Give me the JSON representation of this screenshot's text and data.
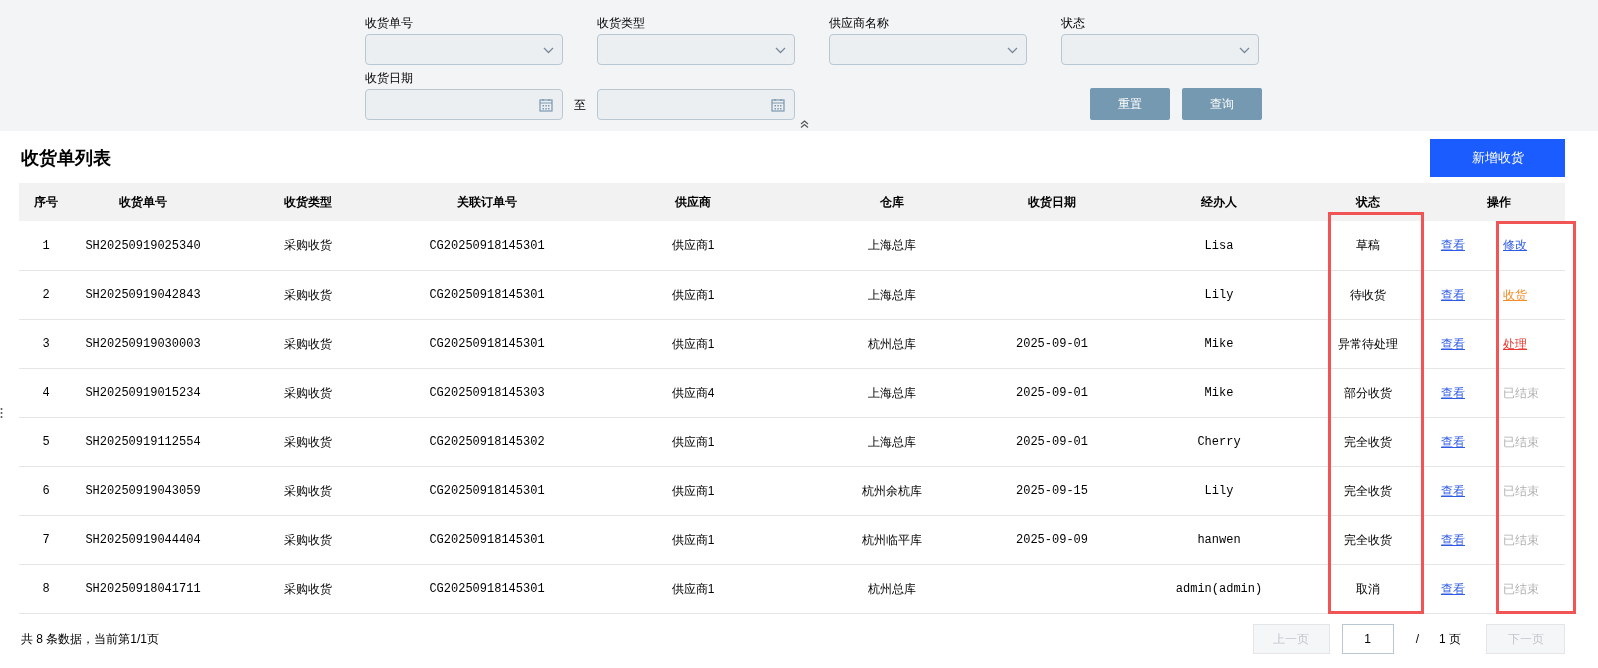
{
  "filters": {
    "selects": [
      {
        "label": "收货单号"
      },
      {
        "label": "收货类型"
      },
      {
        "label": "供应商名称"
      },
      {
        "label": "状态"
      }
    ],
    "date_range": {
      "label": "收货日期",
      "separator": "至"
    },
    "buttons": [
      "重置",
      "查询"
    ]
  },
  "list": {
    "title": "收货单列表",
    "add_button": "新增收货",
    "columns": [
      "序号",
      "收货单号",
      "收货类型",
      "关联订单号",
      "供应商",
      "仓库",
      "收货日期",
      "经办人",
      "状态",
      "操作"
    ],
    "rows": [
      {
        "no": "1",
        "receipt_no": "SH20250919025340",
        "type": "采购收货",
        "order_no": "CG20250918145301",
        "supplier": "供应商1",
        "warehouse": "上海总库",
        "date": "",
        "handler": "Lisa",
        "status": "草稿",
        "view": "查看",
        "action": {
          "label": "修改",
          "kind": "edit"
        }
      },
      {
        "no": "2",
        "receipt_no": "SH20250919042843",
        "type": "采购收货",
        "order_no": "CG20250918145301",
        "supplier": "供应商1",
        "warehouse": "上海总库",
        "date": "",
        "handler": "Lily",
        "status": "待收货",
        "view": "查看",
        "action": {
          "label": "收货",
          "kind": "receive"
        }
      },
      {
        "no": "3",
        "receipt_no": "SH20250919030003",
        "type": "采购收货",
        "order_no": "CG20250918145301",
        "supplier": "供应商1",
        "warehouse": "杭州总库",
        "date": "2025-09-01",
        "handler": "Mike",
        "status": "异常待处理",
        "view": "查看",
        "action": {
          "label": "处理",
          "kind": "process"
        }
      },
      {
        "no": "4",
        "receipt_no": "SH20250919015234",
        "type": "采购收货",
        "order_no": "CG20250918145303",
        "supplier": "供应商4",
        "warehouse": "上海总库",
        "date": "2025-09-01",
        "handler": "Mike",
        "status": "部分收货",
        "view": "查看",
        "action": {
          "label": "已结束",
          "kind": "closed"
        }
      },
      {
        "no": "5",
        "receipt_no": "SH20250919112554",
        "type": "采购收货",
        "order_no": "CG20250918145302",
        "supplier": "供应商1",
        "warehouse": "上海总库",
        "date": "2025-09-01",
        "handler": "Cherry",
        "status": "完全收货",
        "view": "查看",
        "action": {
          "label": "已结束",
          "kind": "closed"
        }
      },
      {
        "no": "6",
        "receipt_no": "SH20250919043059",
        "type": "采购收货",
        "order_no": "CG20250918145301",
        "supplier": "供应商1",
        "warehouse": "杭州余杭库",
        "date": "2025-09-15",
        "handler": "Lily",
        "status": "完全收货",
        "view": "查看",
        "action": {
          "label": "已结束",
          "kind": "closed"
        }
      },
      {
        "no": "7",
        "receipt_no": "SH20250919044404",
        "type": "采购收货",
        "order_no": "CG20250918145301",
        "supplier": "供应商1",
        "warehouse": "杭州临平库",
        "date": "2025-09-09",
        "handler": "hanwen",
        "status": "完全收货",
        "view": "查看",
        "action": {
          "label": "已结束",
          "kind": "closed"
        }
      },
      {
        "no": "8",
        "receipt_no": "SH20250918041711",
        "type": "采购收货",
        "order_no": "CG20250918145301",
        "supplier": "供应商1",
        "warehouse": "杭州总库",
        "date": "",
        "handler": "admin(admin)",
        "status": "取消",
        "view": "查看",
        "action": {
          "label": "已结束",
          "kind": "closed"
        }
      }
    ]
  },
  "pagination": {
    "summary": "共 8 条数据，当前第1/1页",
    "prev": "上一页",
    "page": "1",
    "slash": "/",
    "total": "1 页",
    "next": "下一页"
  }
}
